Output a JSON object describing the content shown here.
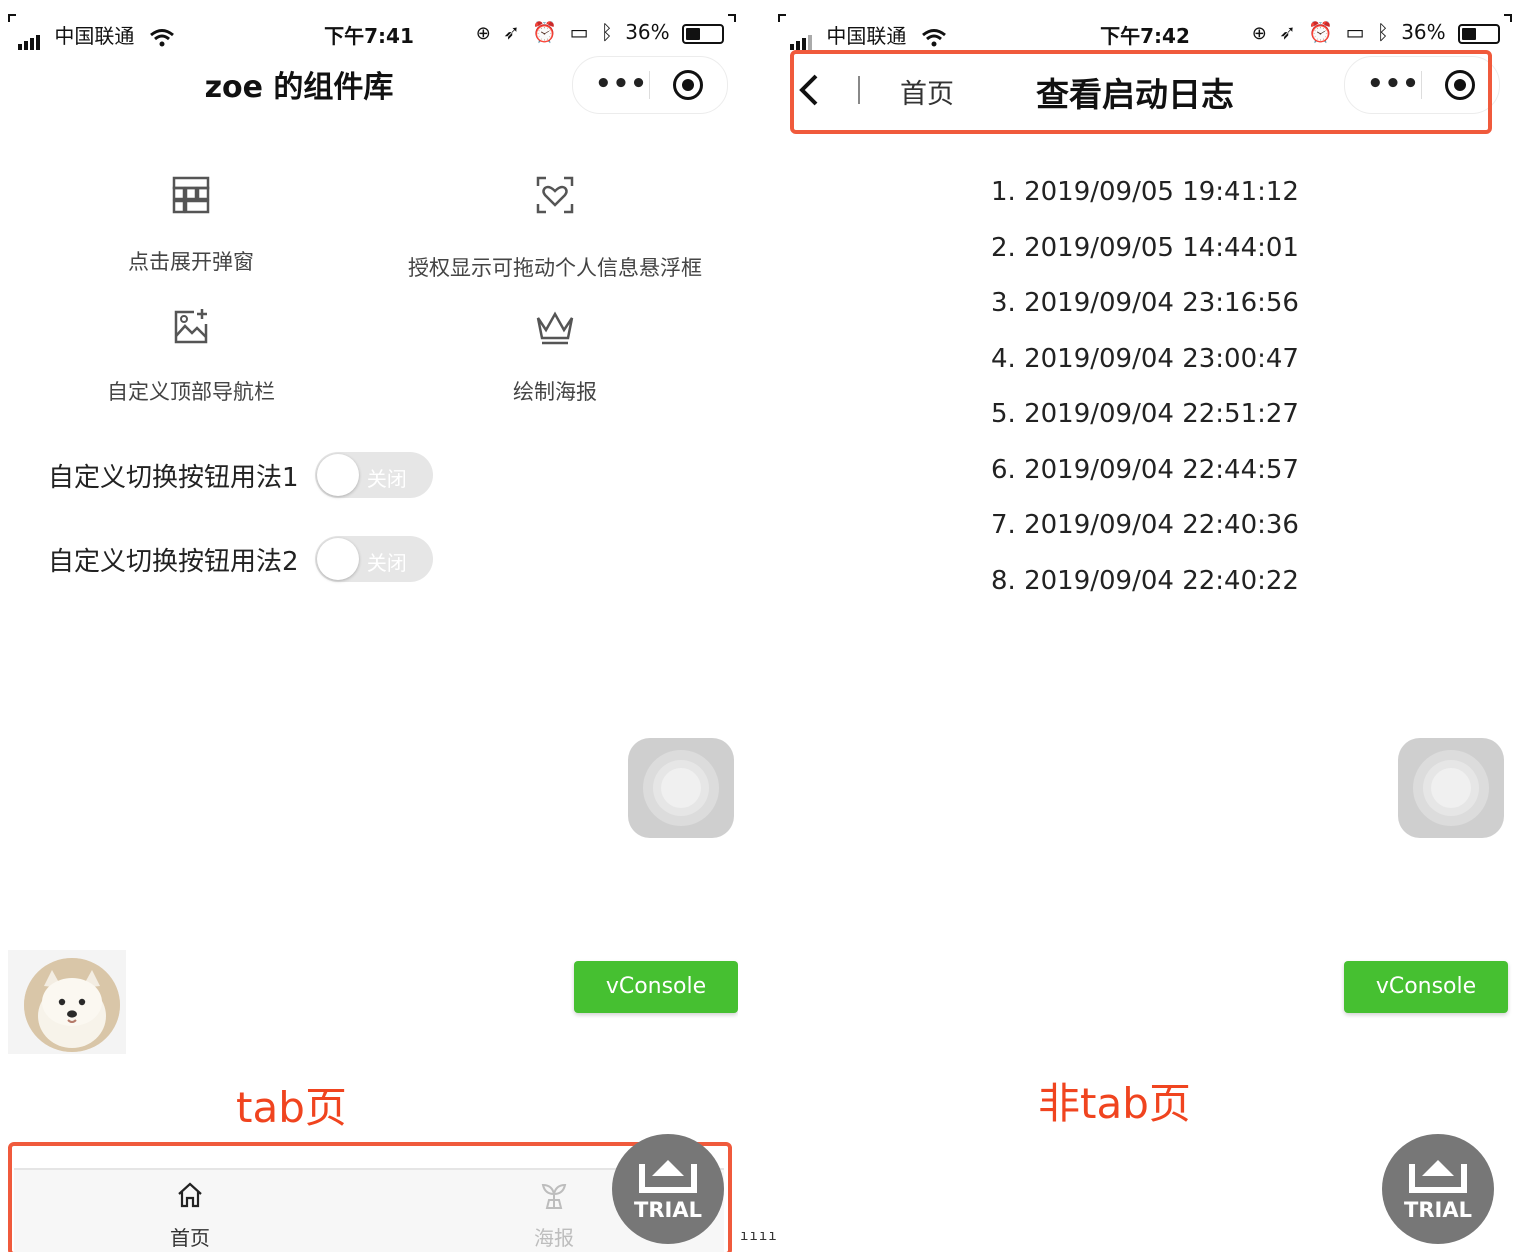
{
  "left_screen": {
    "status": {
      "carrier": "中国联通",
      "time": "下午7:41",
      "battery": "36%"
    },
    "nav": {
      "title": "zoe 的组件库"
    },
    "grid": [
      {
        "icon": "grid-layout-icon",
        "label": "点击展开弹窗"
      },
      {
        "icon": "heart-scan-icon",
        "label": "授权显示可拖动个人信息悬浮框"
      },
      {
        "icon": "image-add-icon",
        "label": "自定义顶部导航栏"
      },
      {
        "icon": "crown-icon",
        "label": "绘制海报"
      }
    ],
    "switches": [
      {
        "label": "自定义切换按钮用法1",
        "state": "关闭"
      },
      {
        "label": "自定义切换按钮用法2",
        "state": "关闭"
      }
    ],
    "vconsole": "vConsole",
    "caption": "tab页",
    "tabs": [
      {
        "icon": "home-icon",
        "label": "首页"
      },
      {
        "icon": "sprout-icon",
        "label": "海报"
      }
    ],
    "trial": "TRIAL"
  },
  "right_screen": {
    "status": {
      "carrier": "中国联通",
      "time": "下午7:42",
      "battery": "36%"
    },
    "nav": {
      "home": "首页",
      "title": "查看启动日志"
    },
    "log": [
      "1. 2019/09/05 19:41:12",
      "2. 2019/09/05 14:44:01",
      "3. 2019/09/04 23:16:56",
      "4. 2019/09/04 23:00:47",
      "5. 2019/09/04 22:51:27",
      "6. 2019/09/04 22:44:57",
      "7. 2019/09/04 22:40:36",
      "8. 2019/09/04 22:40:22"
    ],
    "vconsole": "vConsole",
    "caption": "非tab页",
    "trial": "TRIAL"
  },
  "colors": {
    "accent_red": "#f05a3c",
    "vconsole_green": "#46c031",
    "switch_off": "#e6e6e6"
  }
}
